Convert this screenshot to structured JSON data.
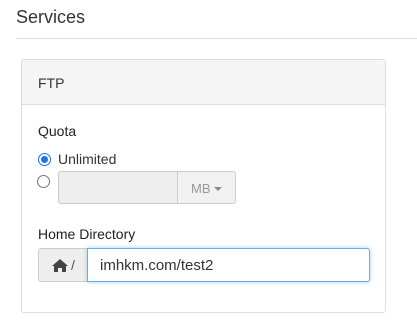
{
  "page": {
    "section_title": "Services"
  },
  "ftp_panel": {
    "title": "FTP",
    "quota": {
      "label": "Quota",
      "unlimited_label": "Unlimited",
      "selected": "unlimited",
      "custom_value": "",
      "unit": "MB"
    },
    "home_directory": {
      "label": "Home Directory",
      "prefix": "/",
      "value": "imhkm.com/test2"
    }
  },
  "colors": {
    "accent": "#1a73e8",
    "focus_border": "#66afe9"
  },
  "icons": {
    "home": "home-icon",
    "dropdown": "caret-down-icon"
  }
}
